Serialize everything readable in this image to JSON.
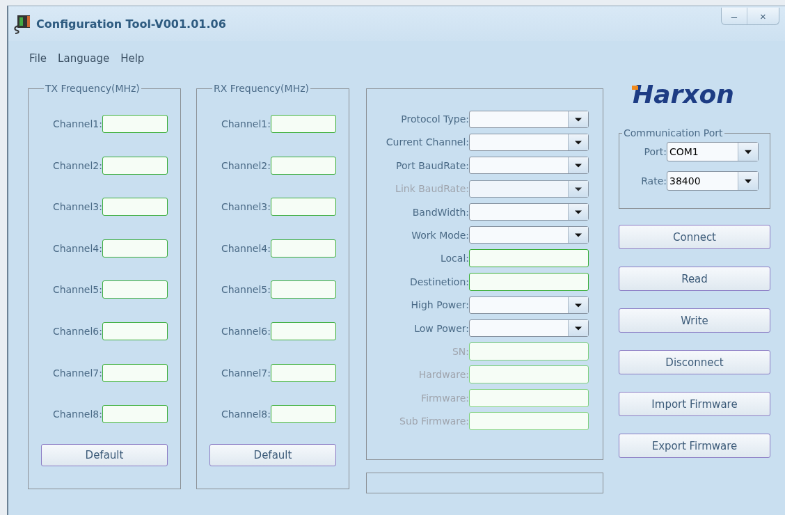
{
  "window": {
    "title": "Configuration Tool-V001.01.06",
    "controls": [
      "–",
      "×"
    ]
  },
  "menu": [
    "File",
    "Language",
    "Help"
  ],
  "tx": {
    "title": "TX Frequency(MHz)",
    "channels": [
      "Channel1:",
      "Channel2:",
      "Channel3:",
      "Channel4:",
      "Channel5:",
      "Channel6:",
      "Channel7:",
      "Channel8:"
    ],
    "button": "Default"
  },
  "rx": {
    "title": "RX Frequency(MHz)",
    "channels": [
      "Channel1:",
      "Channel2:",
      "Channel3:",
      "Channel4:",
      "Channel5:",
      "Channel6:",
      "Channel7:",
      "Channel8:"
    ],
    "button": "Default"
  },
  "settings": [
    {
      "label": "Protocol Type:",
      "kind": "select",
      "disabled": false
    },
    {
      "label": "Current Channel:",
      "kind": "select",
      "disabled": false
    },
    {
      "label": "Port BaudRate:",
      "kind": "select",
      "disabled": false
    },
    {
      "label": "Link BaudRate:",
      "kind": "select",
      "disabled": true
    },
    {
      "label": "BandWidth:",
      "kind": "select",
      "disabled": false
    },
    {
      "label": "Work Mode:",
      "kind": "select",
      "disabled": false
    },
    {
      "label": "Local:",
      "kind": "text",
      "disabled": false
    },
    {
      "label": "Destinetion:",
      "kind": "text",
      "disabled": false
    },
    {
      "label": "High Power:",
      "kind": "select",
      "disabled": false
    },
    {
      "label": "Low Power:",
      "kind": "select",
      "disabled": false
    },
    {
      "label": "SN:",
      "kind": "text",
      "disabled": true
    },
    {
      "label": "Hardware:",
      "kind": "text",
      "disabled": true
    },
    {
      "label": "Firmware:",
      "kind": "text",
      "disabled": true
    },
    {
      "label": "Sub Firmware:",
      "kind": "text",
      "disabled": true
    }
  ],
  "logo": "Harxon",
  "communication_port": {
    "title": "Communication Port",
    "fields": [
      {
        "label": "Port:",
        "value": "COM1"
      },
      {
        "label": "Rate:",
        "value": "38400"
      }
    ]
  },
  "buttons": [
    "Connect",
    "Read",
    "Write",
    "Disconnect",
    "Import Firmware",
    "Export Firmware"
  ]
}
